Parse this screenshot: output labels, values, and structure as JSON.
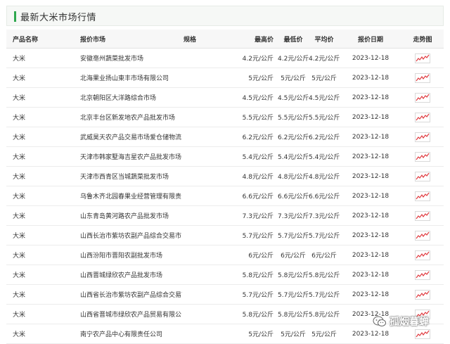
{
  "header": {
    "title": "最新大米市场行情"
  },
  "columns": {
    "name": "产品名称",
    "market": "报价市场",
    "spec": "规格",
    "high": "最高价",
    "low": "最低价",
    "avg": "平均价",
    "date": "报价日期",
    "trend": "走势图"
  },
  "rows": [
    {
      "name": "大米",
      "market": "安徽亳州蔬菜批发市场",
      "spec": "",
      "high": "4.2元/公斤",
      "low": "4.2元/公斤",
      "avg": "4.2元/公斤",
      "date": "2023-12-18"
    },
    {
      "name": "大米",
      "market": "北海果业扬山東丰市场有限公司",
      "spec": "",
      "high": "5元/公斤",
      "low": "5元/公斤",
      "avg": "5元/公斤",
      "date": "2023-12-18"
    },
    {
      "name": "大米",
      "market": "北京朝阳区大洋路综合市场",
      "spec": "",
      "high": "4.5元/公斤",
      "low": "4.5元/公斤",
      "avg": "4.5元/公斤",
      "date": "2023-12-18"
    },
    {
      "name": "大米",
      "market": "北京丰台区新发地农产品批发市场",
      "spec": "",
      "high": "5.5元/公斤",
      "low": "5.5元/公斤",
      "avg": "5.5元/公斤",
      "date": "2023-12-18"
    },
    {
      "name": "大米",
      "market": "武威昊天农产品交易市场爱仓储物流",
      "spec": "",
      "high": "6.2元/公斤",
      "low": "6.2元/公斤",
      "avg": "6.2元/公斤",
      "date": "2023-12-18"
    },
    {
      "name": "大米",
      "market": "天津市韩家墅海吉星农产品批发市场",
      "spec": "",
      "high": "5.4元/公斤",
      "low": "5.4元/公斤",
      "avg": "5.4元/公斤",
      "date": "2023-12-18"
    },
    {
      "name": "大米",
      "market": "天津市西青区当城蔬菜批发市场",
      "spec": "",
      "high": "4.8元/公斤",
      "low": "4.8元/公斤",
      "avg": "4.8元/公斤",
      "date": "2023-12-18"
    },
    {
      "name": "大米",
      "market": "乌鲁木齐北园春果业经营管理有限责",
      "spec": "",
      "high": "6.6元/公斤",
      "low": "6.6元/公斤",
      "avg": "6.6元/公斤",
      "date": "2023-12-18"
    },
    {
      "name": "大米",
      "market": "山东青岛黄河路农产品批发市场",
      "spec": "",
      "high": "7.3元/公斤",
      "low": "7.3元/公斤",
      "avg": "7.3元/公斤",
      "date": "2023-12-18"
    },
    {
      "name": "大米",
      "market": "山西长治市紫坊农副产品综合交易市",
      "spec": "",
      "high": "5.7元/公斤",
      "low": "5.7元/公斤",
      "avg": "5.7元/公斤",
      "date": "2023-12-18"
    },
    {
      "name": "大米",
      "market": "山西汾阳市晋阳农副批发市场",
      "spec": "",
      "high": "6元/公斤",
      "low": "6元/公斤",
      "avg": "6元/公斤",
      "date": "2023-12-18"
    },
    {
      "name": "大米",
      "market": "山西晋城绿欣农产品批发市场",
      "spec": "",
      "high": "5.8元/公斤",
      "low": "5.8元/公斤",
      "avg": "5.8元/公斤",
      "date": "2023-12-18"
    },
    {
      "name": "大米",
      "market": "山西省长治市紫坊农副产品综合交易市",
      "spec": "",
      "high": "5.7元/公斤",
      "low": "5.7元/公斤",
      "avg": "5.7元/公斤",
      "date": "2023-12-18"
    },
    {
      "name": "大米",
      "market": "山西省晋城市绿欣农产品贸易有限公",
      "spec": "",
      "high": "5.8元/公斤",
      "low": "5.8元/公斤",
      "avg": "5.8元/公斤",
      "date": "2023-12-18"
    },
    {
      "name": "大米",
      "market": "南宁农产品中心有限责任公司",
      "spec": "",
      "high": "5元/公斤",
      "low": "5元/公斤",
      "avg": "5元/公斤",
      "date": "2023-12-18"
    }
  ],
  "trend_icon": "trend-chart-icon",
  "colors": {
    "accent": "#2fa84f",
    "trend_line": "#e0393e"
  },
  "watermark": {
    "text": "孤烟暮蝉",
    "icon": "wechat-icon"
  }
}
